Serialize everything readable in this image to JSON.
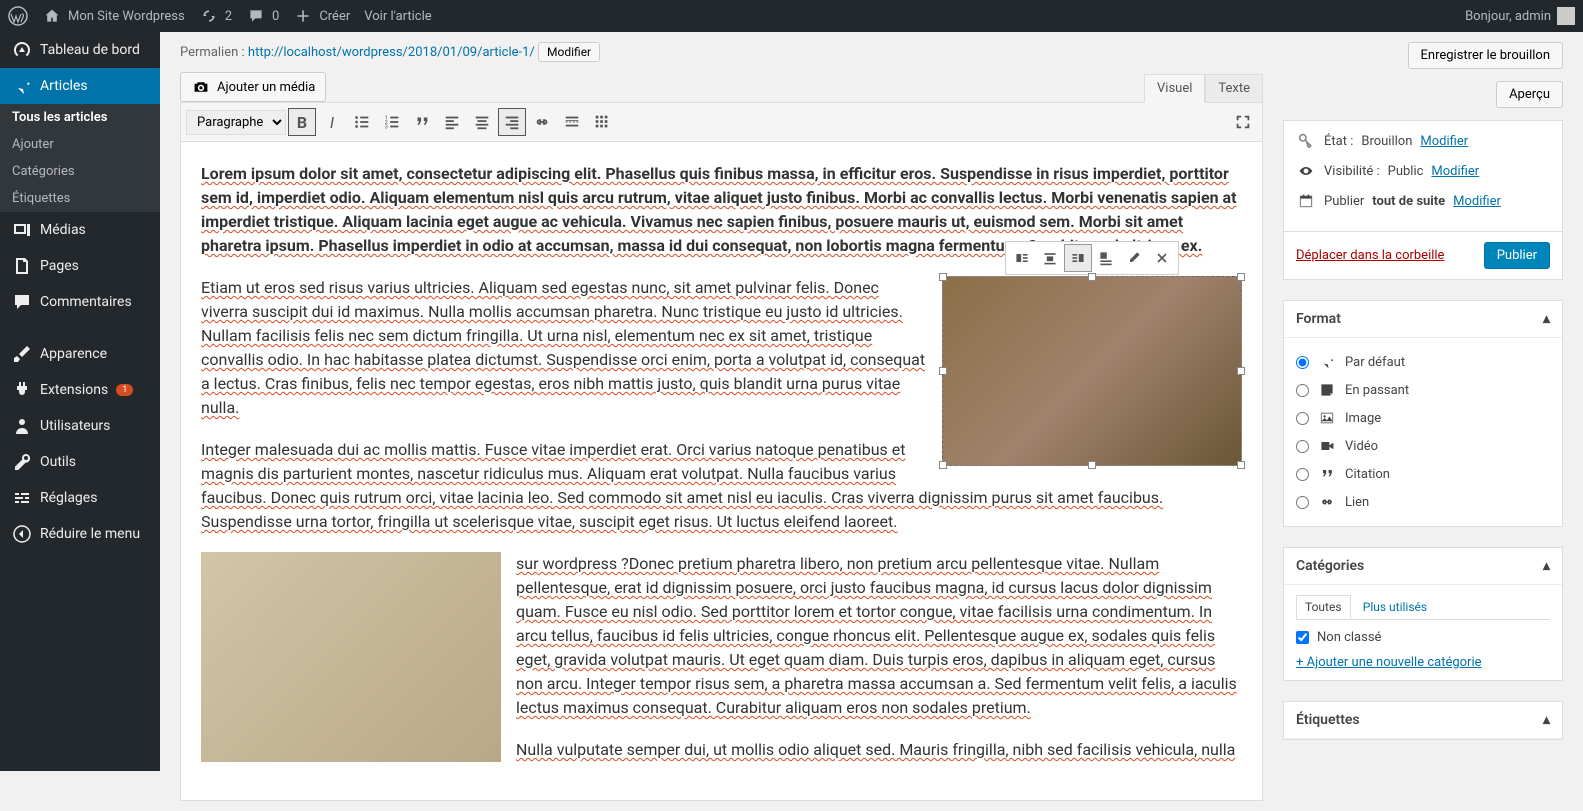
{
  "adminbar": {
    "site_name": "Mon Site Wordpress",
    "updates_count": "2",
    "comments_count": "0",
    "create_label": "Créer",
    "view_article": "Voir l'article",
    "greeting": "Bonjour, admin"
  },
  "sidebar": {
    "dashboard": "Tableau de bord",
    "articles": "Articles",
    "sub": {
      "all": "Tous les articles",
      "add": "Ajouter",
      "categories": "Catégories",
      "tags": "Étiquettes"
    },
    "media": "Médias",
    "pages": "Pages",
    "comments": "Commentaires",
    "appearance": "Apparence",
    "extensions": "Extensions",
    "extensions_badge": "1",
    "users": "Utilisateurs",
    "tools": "Outils",
    "settings": "Réglages",
    "collapse": "Réduire le menu"
  },
  "permalink": {
    "label": "Permalien :",
    "url_base": "http://localhost/wordpress/2018/01/09/",
    "slug": "article-1/",
    "edit": "Modifier"
  },
  "media_button": "Ajouter un média",
  "editor_tabs": {
    "visual": "Visuel",
    "text": "Texte"
  },
  "toolbar": {
    "format_select": "Paragraphe"
  },
  "content": {
    "p1": "Lorem ipsum dolor sit amet, consectetur adipiscing elit. Phasellus quis finibus massa, in efficitur eros. Suspendisse in risus imperdiet, porttitor sem id, imperdiet odio. Aliquam elementum nisl quis arcu rutrum, vitae aliquet justo finibus. Morbi ac convallis lectus. Morbi venenatis sapien at imperdiet tristique. Aliquam lacinia eget augue ac vehicula. Vivamus nec sapien finibus, posuere mauris ut, euismod sem. Morbi sit amet pharetra ipsum. Phasellus imperdiet in odio at accumsan, massa id dui consequat, non lobortis magna fermentum. Curabitur vel ultrices ex.",
    "p2": "Etiam ut eros sed risus varius ultricies. Aliquam sed egestas nunc, sit amet pulvinar felis. Donec viverra suscipit dui id maximus. Nulla mollis accumsan pharetra. Nunc tristique eu justo id ultricies. Nullam facilisis felis nec sem dictum fringilla. Ut urna nisl, elementum nec ex sit amet, tristique convallis odio. In hac habitasse platea dictumst. Suspendisse orci enim, porta a volutpat id, consequat a lectus. Cras finibus, felis nec tempor egestas, eros nibh mattis justo, quis blandit urna purus vitae nulla.",
    "p3": "Integer malesuada dui ac mollis mattis. Fusce vitae imperdiet erat. Orci varius natoque penatibus et magnis dis parturient montes, nascetur ridiculus mus. Aliquam erat volutpat. Nulla faucibus varius faucibus. Donec quis rutrum orci, vitae lacinia leo. Sed commodo sit amet nisl eu iaculis. Cras viverra dignissim purus sit amet faucibus. Suspendisse urna tortor, fringilla ut scelerisque vitae, suscipit eget risus. Ut luctus eleifend laoreet.",
    "p4": "sur wordpress ?Donec pretium pharetra libero, non pretium arcu pellentesque vitae. Nullam pellentesque, erat id dignissim posuere, orci justo faucibus magna, id cursus lacus dolor dignissim quam. Fusce eu nisl odio. Sed porttitor lorem et tortor congue, vitae facilisis urna condimentum. In arcu tellus, faucibus id felis ultricies, congue rhoncus elit. Pellentesque augue ex, sodales quis felis eget, gravida volutpat mauris. Ut eget quam diam. Duis turpis eros, dapibus in aliquam eget, cursus non arcu. Integer tempor risus sem, a pharetra massa accumsan a. Sed fermentum velit felis, a iaculis lectus maximus consequat. Curabitur aliquam eros non sodales pretium.",
    "p5": "Nulla vulputate semper dui, ut mollis odio aliquet sed. Mauris fringilla, nibh sed facilisis vehicula, nulla"
  },
  "publish": {
    "save_draft": "Enregistrer le brouillon",
    "preview": "Aperçu",
    "state_label": "État :",
    "state_value": "Brouillon",
    "visibility_label": "Visibilité :",
    "visibility_value": "Public",
    "schedule_label": "Publier",
    "schedule_value": "tout de suite",
    "modify": "Modifier",
    "trash": "Déplacer dans la corbeille",
    "publish_btn": "Publier"
  },
  "format": {
    "title": "Format",
    "default": "Par défaut",
    "aside": "En passant",
    "image": "Image",
    "video": "Vidéo",
    "quote": "Citation",
    "link": "Lien"
  },
  "categories": {
    "title": "Catégories",
    "tab_all": "Toutes",
    "tab_most": "Plus utilisés",
    "uncategorized": "Non classé",
    "add_new": "+ Ajouter une nouvelle catégorie"
  },
  "tags_panel": {
    "title": "Étiquettes"
  }
}
